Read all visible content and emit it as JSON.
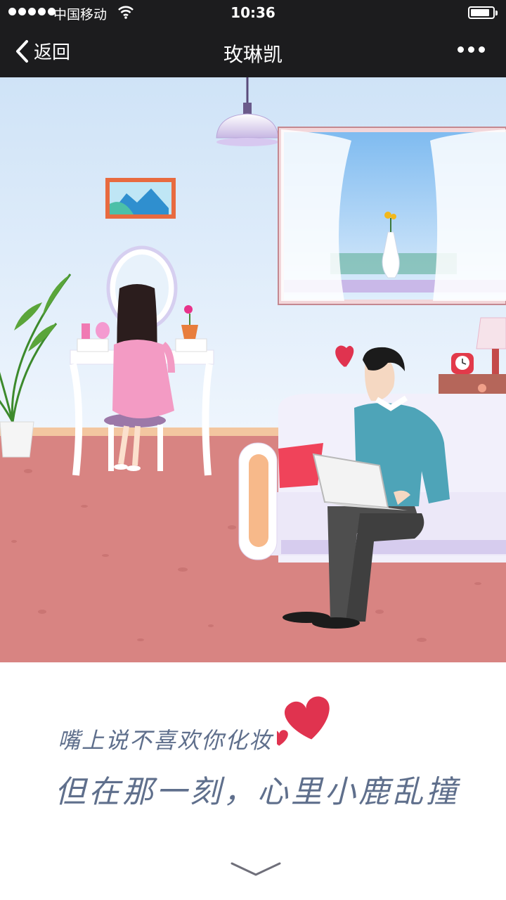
{
  "status_bar": {
    "carrier": "中国移动",
    "time": "10:36"
  },
  "nav": {
    "back_label": "返回",
    "title": "玫琳凯"
  },
  "caption": {
    "line1": "嘴上说不喜欢你化妆",
    "line2": "但在那一刻，心里小鹿乱撞"
  },
  "colors": {
    "nav_bg": "#1c1c1e",
    "caption_text": "#5f6f8c",
    "heart": "#e0334f",
    "floor": "#d88482",
    "wall": "#e8f1fb"
  },
  "icons": {
    "back": "chevron-left-icon",
    "more": "more-dots-icon",
    "scroll": "chevron-down-icon"
  }
}
